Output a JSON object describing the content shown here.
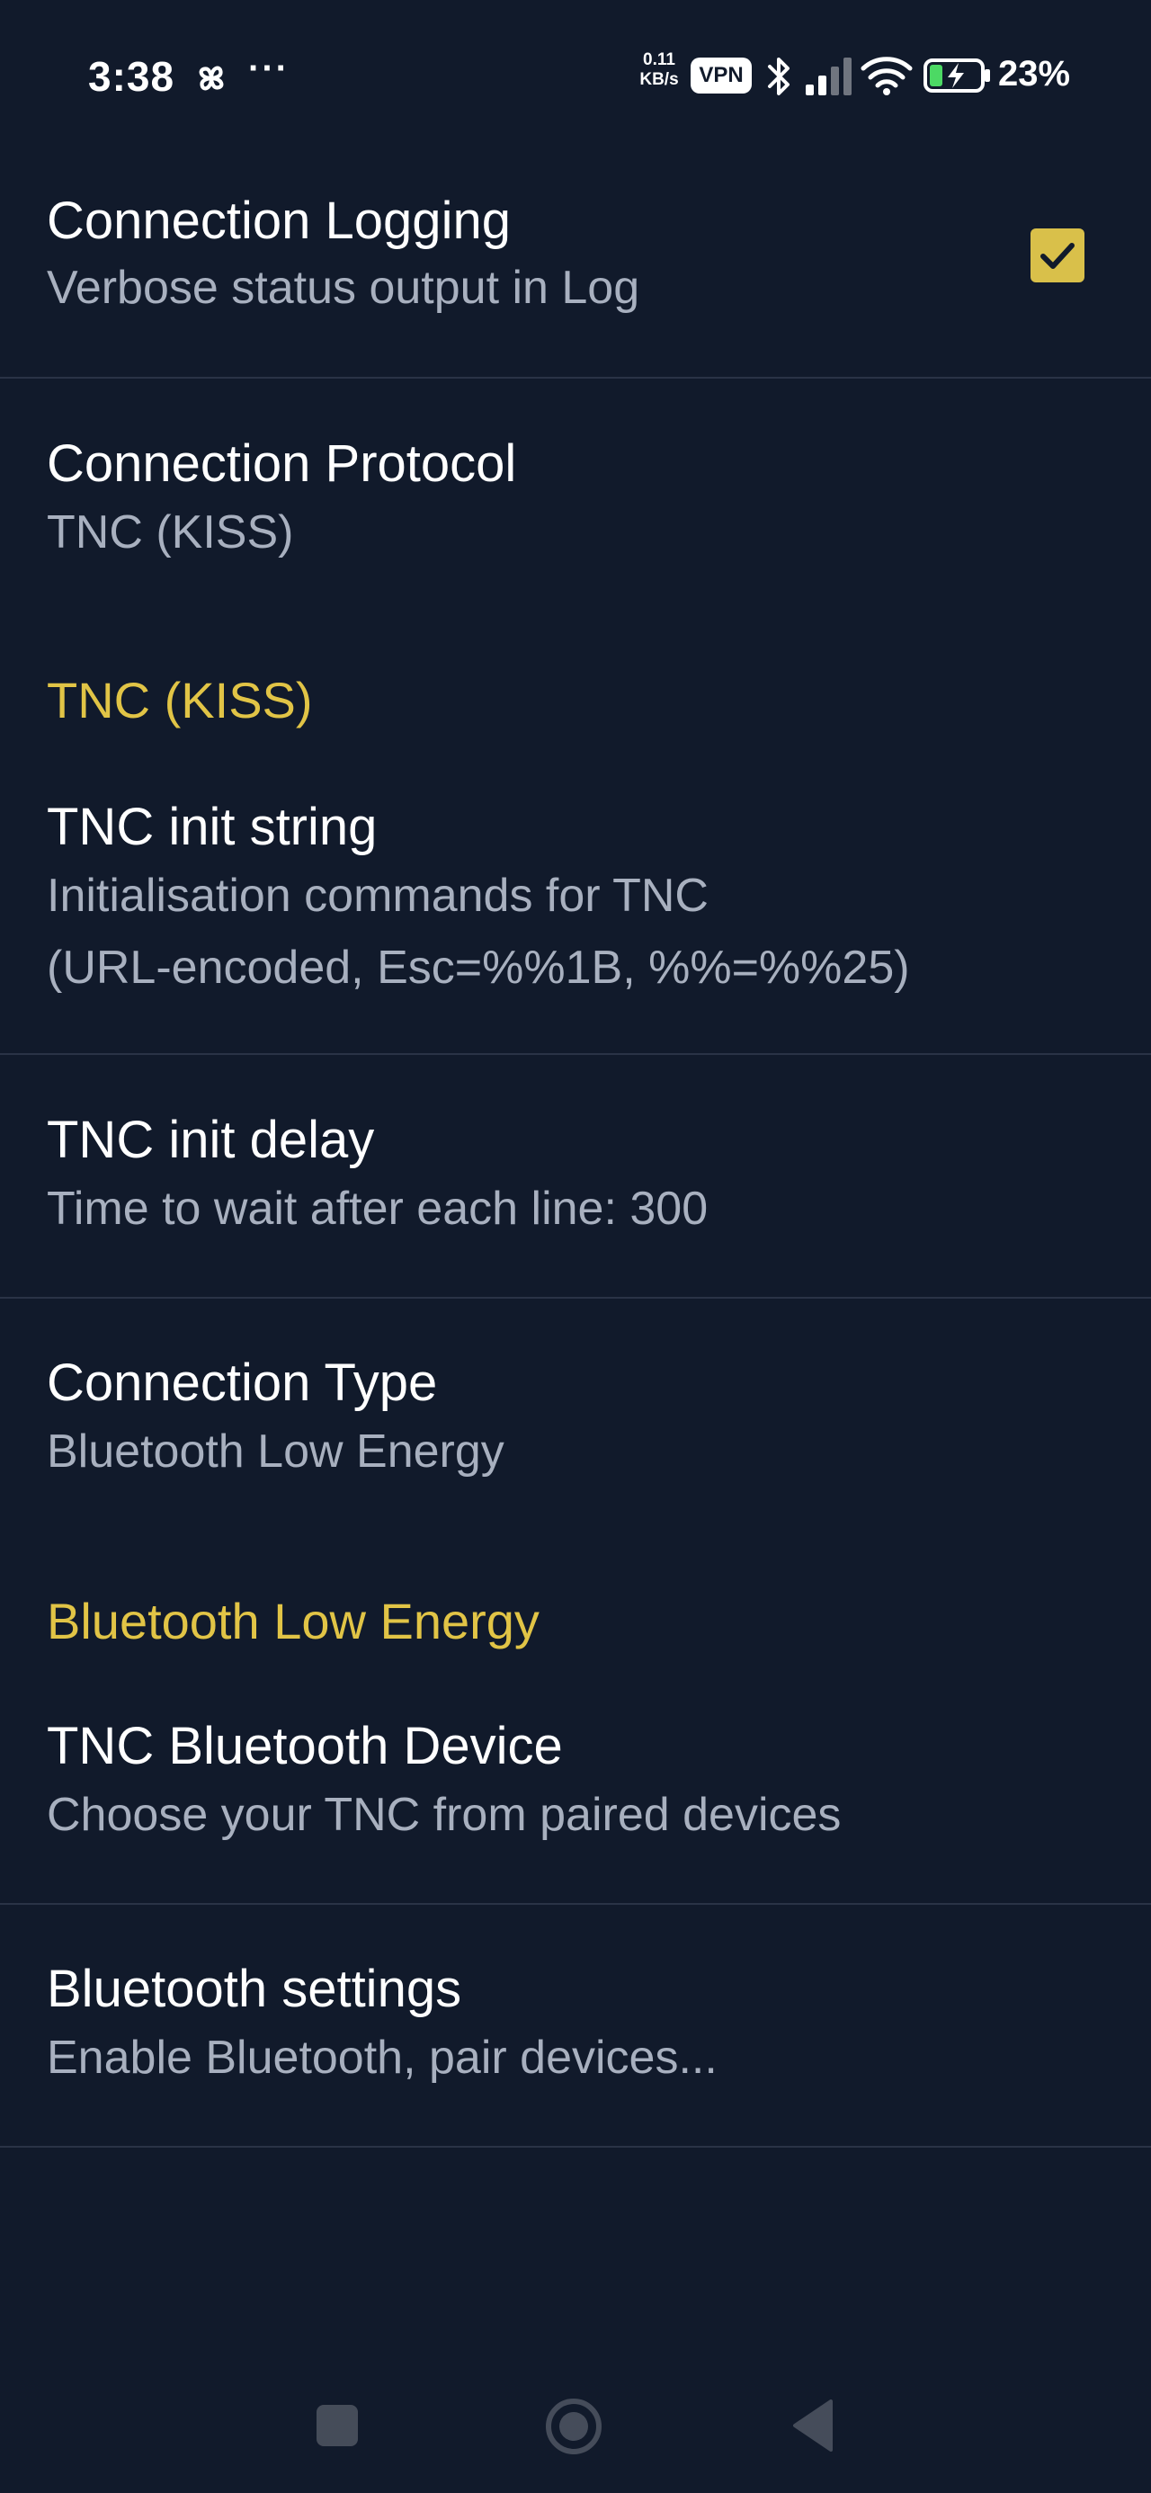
{
  "status_bar": {
    "time": "3:38",
    "dots": "···",
    "net_speed_value": "0.11",
    "net_speed_unit": "KB/s",
    "vpn_label": "VPN",
    "battery_percent": "23%",
    "icons": [
      "pinwheel-icon",
      "bluetooth-icon",
      "signal-icon",
      "wifi-icon",
      "battery-charging-icon"
    ]
  },
  "prefs": {
    "connection_logging": {
      "title": "Connection Logging",
      "summary": "Verbose status output in Log",
      "checked": true
    },
    "connection_protocol": {
      "title": "Connection Protocol",
      "summary": "TNC (KISS)"
    },
    "category_tnc": "TNC (KISS)",
    "tnc_init_string": {
      "title": "TNC init string",
      "summary_line1": "Initialisation commands for TNC",
      "summary_line2": "(URL-encoded, Esc=%%1B, %%=%%25)"
    },
    "tnc_init_delay": {
      "title": "TNC init delay",
      "summary": "Time to wait after each line: 300"
    },
    "connection_type": {
      "title": "Connection Type",
      "summary": "Bluetooth Low Energy"
    },
    "category_ble": "Bluetooth Low Energy",
    "tnc_bluetooth_device": {
      "title": "TNC Bluetooth Device",
      "summary": "Choose your TNC from paired devices"
    },
    "bluetooth_settings": {
      "title": "Bluetooth settings",
      "summary": "Enable Bluetooth, pair devices..."
    }
  },
  "colors": {
    "background": "#111a2b",
    "accent": "#e1c446",
    "summary_text": "#a8b0bf",
    "divider": "#2a3346"
  },
  "nav_bar": {
    "icons": [
      "recents-square-icon",
      "home-circle-icon",
      "back-triangle-icon"
    ]
  }
}
